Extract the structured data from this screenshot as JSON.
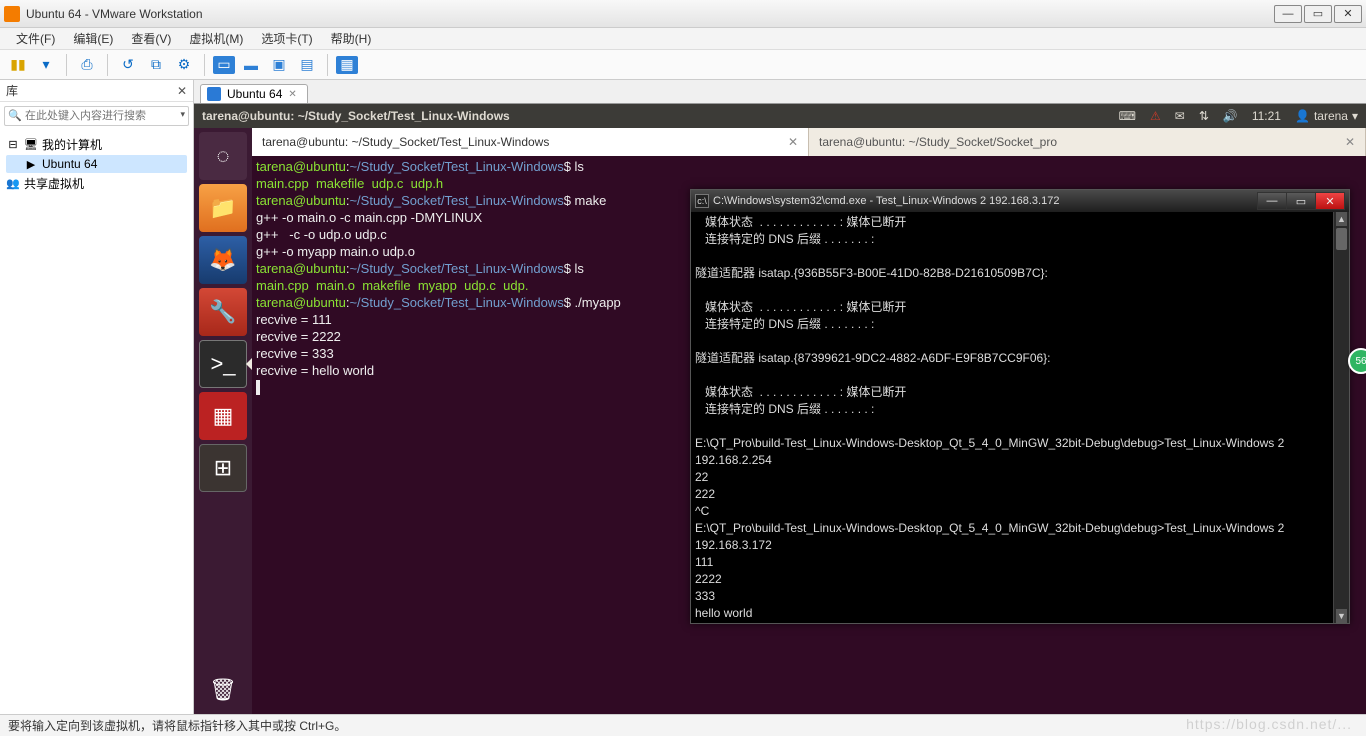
{
  "window": {
    "title": "Ubuntu 64 - VMware Workstation",
    "min": "—",
    "max": "▭",
    "close": "✕"
  },
  "menu": {
    "file": "文件(F)",
    "edit": "编辑(E)",
    "view": "查看(V)",
    "vm": "虚拟机(M)",
    "tabs": "选项卡(T)",
    "help": "帮助(H)"
  },
  "library": {
    "title": "库",
    "search_placeholder": "在此处键入内容进行搜索",
    "tree": {
      "root": "我的计算机",
      "vm": "Ubuntu 64",
      "shared": "共享虚拟机"
    }
  },
  "vmtab": {
    "name": "Ubuntu 64"
  },
  "ubuntu_bar": {
    "title": "tarena@ubuntu: ~/Study_Socket/Test_Linux-Windows",
    "time": "11:21",
    "user": "tarena"
  },
  "term_tabs": {
    "t1": "tarena@ubuntu: ~/Study_Socket/Test_Linux-Windows",
    "t2": "tarena@ubuntu: ~/Study_Socket/Socket_pro"
  },
  "term": {
    "l1_prompt": "tarena@ubuntu",
    "l1_path": "~/Study_Socket/Test_Linux-Windows",
    "l1_cmd": "ls",
    "ls_files": "main.cpp  makefile  udp.c  udp.h",
    "l2_cmd": "make",
    "mk1": "g++ -o main.o -c main.cpp -DMYLINUX",
    "mk2": "g++   -c -o udp.o udp.c",
    "mk3": "g++ -o myapp main.o udp.o",
    "l3_cmd": "ls",
    "ls2a": "main.cpp  main.o  ",
    "ls2b": "makefile  myapp",
    "ls2c": "  udp.c  udp.",
    "ls2d": "",
    "l4_cmd": "./myapp",
    "r1": "recvive = 111",
    "r2": "recvive = 2222",
    "r3": "recvive = 333",
    "r4": "recvive = hello world"
  },
  "cmd": {
    "title": "C:\\Windows\\system32\\cmd.exe - Test_Linux-Windows  2 192.168.3.172",
    "body": "   媒体状态  . . . . . . . . . . . . : 媒体已断开\n   连接特定的 DNS 后缀 . . . . . . . :\n\n隧道适配器 isatap.{936B55F3-B00E-41D0-82B8-D21610509B7C}:\n\n   媒体状态  . . . . . . . . . . . . : 媒体已断开\n   连接特定的 DNS 后缀 . . . . . . . :\n\n隧道适配器 isatap.{87399621-9DC2-4882-A6DF-E9F8B7CC9F06}:\n\n   媒体状态  . . . . . . . . . . . . : 媒体已断开\n   连接特定的 DNS 后缀 . . . . . . . :\n\nE:\\QT_Pro\\build-Test_Linux-Windows-Desktop_Qt_5_4_0_MinGW_32bit-Debug\\debug>Test_Linux-Windows 2 192.168.2.254\n22\n222\n^C\nE:\\QT_Pro\\build-Test_Linux-Windows-Desktop_Qt_5_4_0_MinGW_32bit-Debug\\debug>Test_Linux-Windows 2 192.168.3.172\n111\n2222\n333\nhello world\n"
  },
  "status": {
    "text": "要将输入定向到该虚拟机，请将鼠标指针移入其中或按 Ctrl+G。"
  },
  "badge": {
    "text": "56"
  },
  "watermark": "https://blog.csdn.net/..."
}
